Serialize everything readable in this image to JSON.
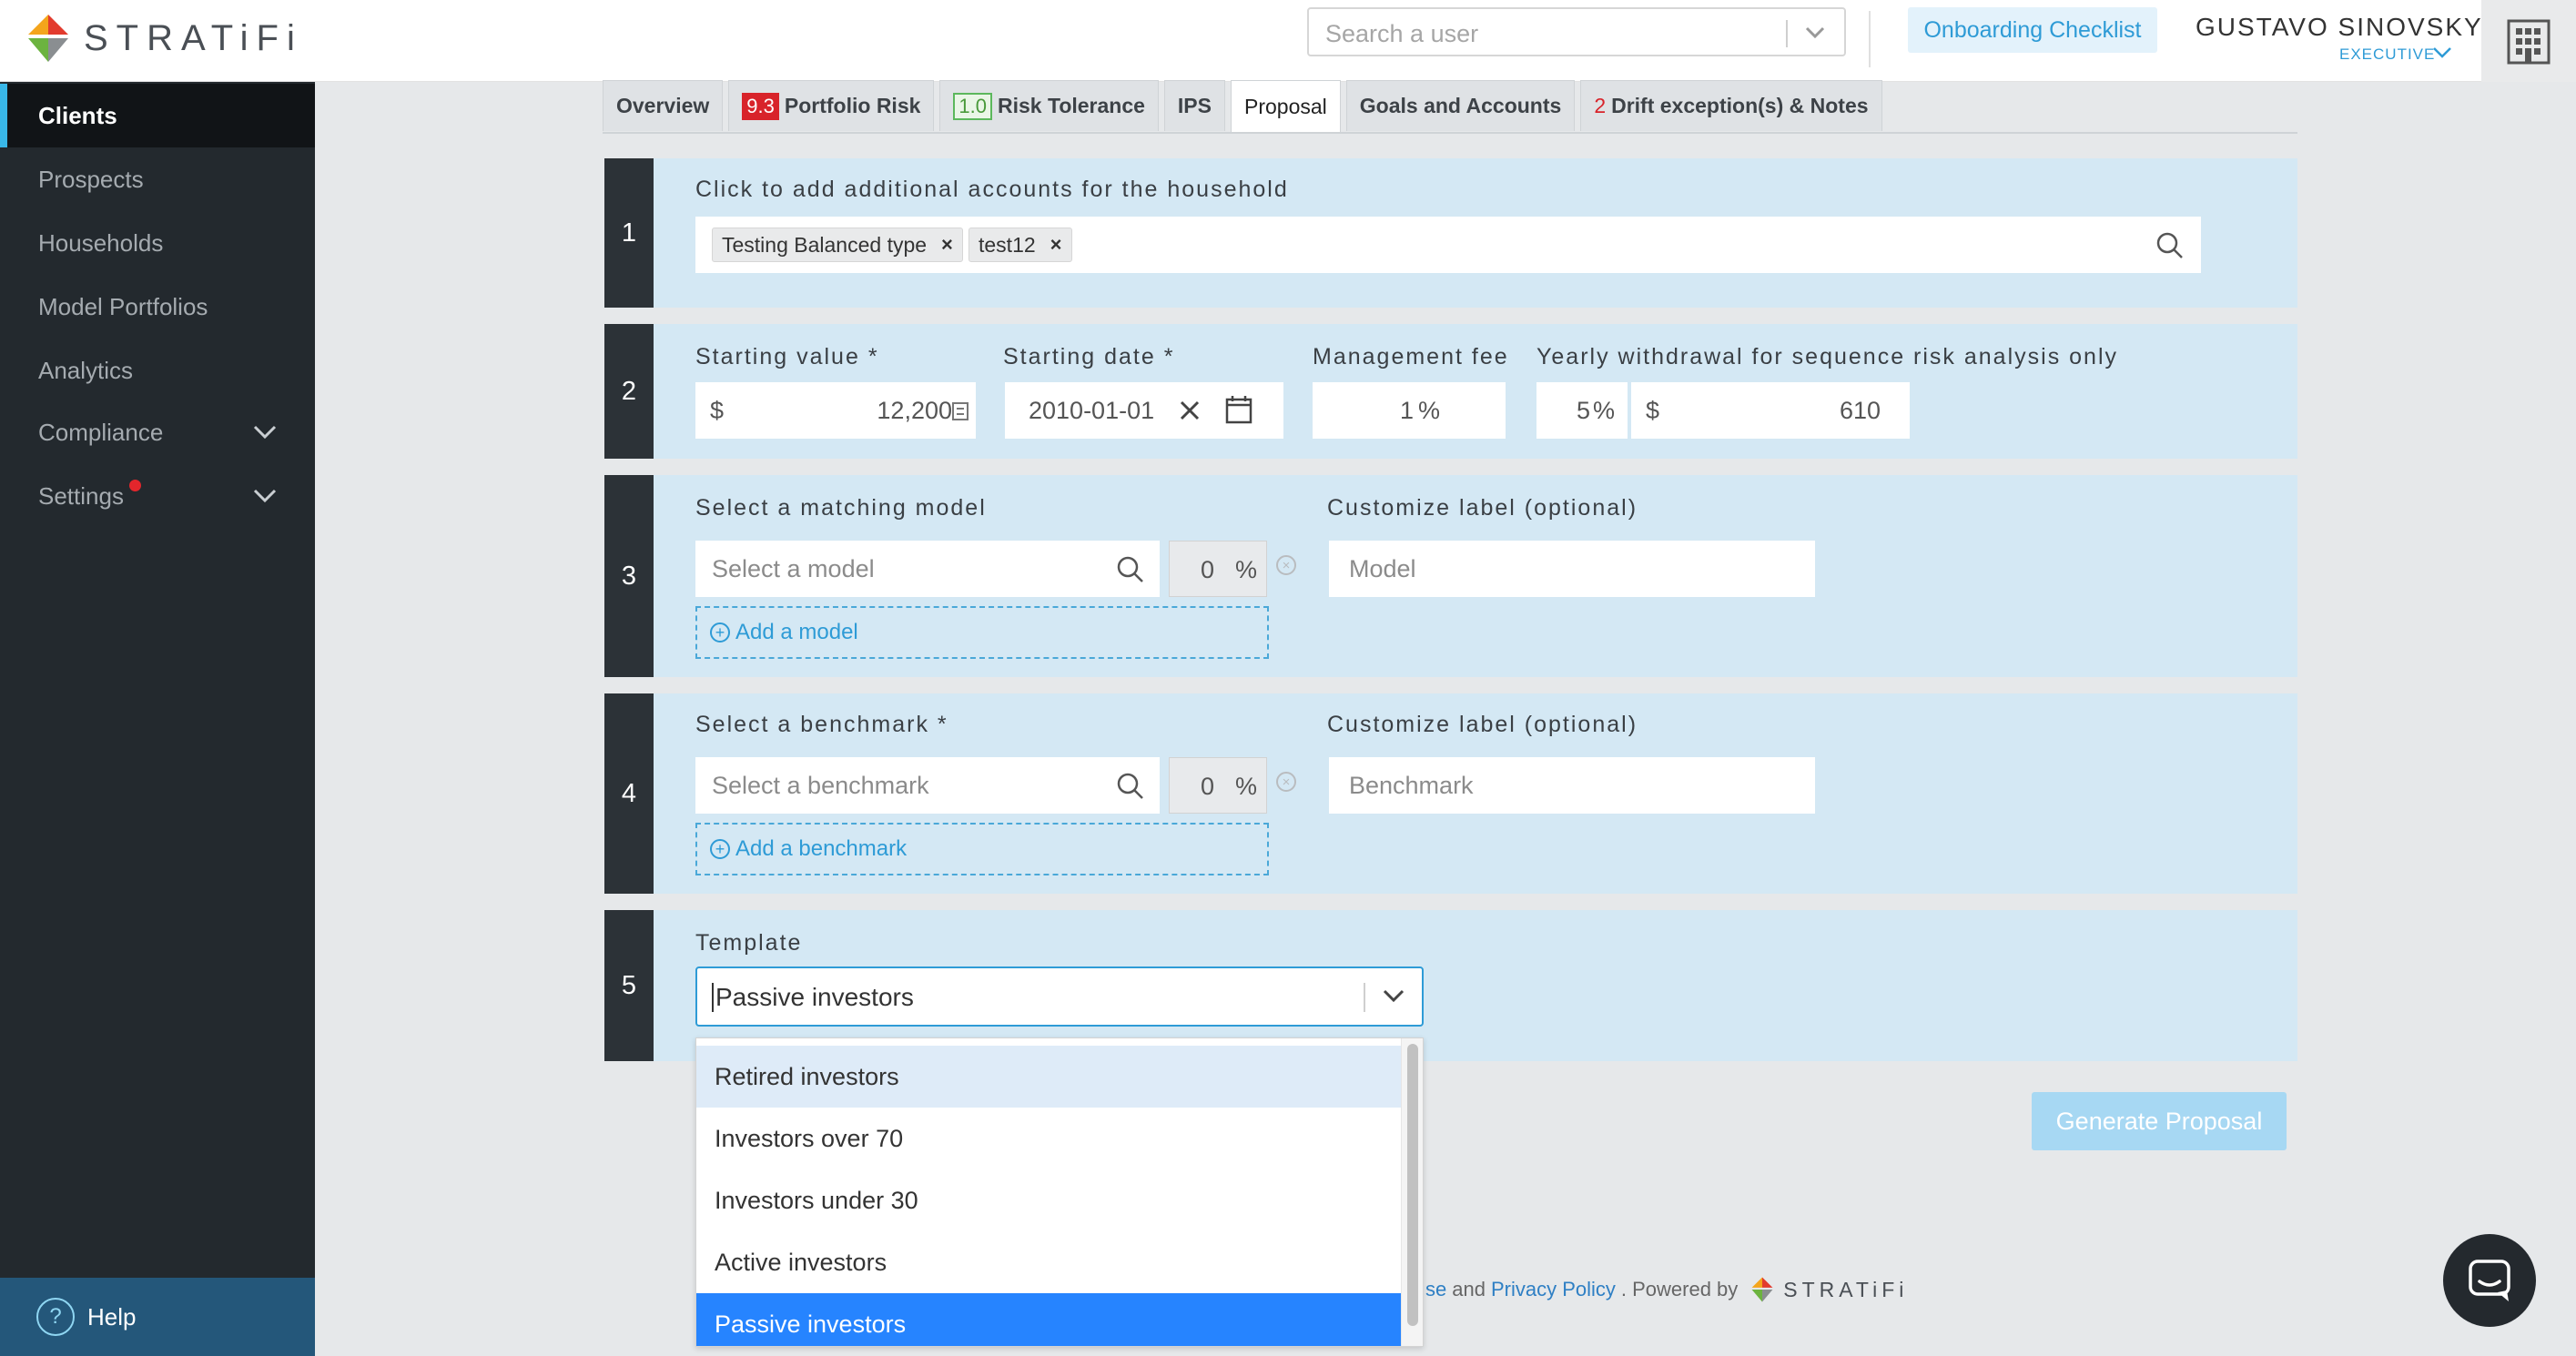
{
  "header": {
    "logo_text": "STRATiFi",
    "search_placeholder": "Search a user",
    "onboarding_label": "Onboarding Checklist",
    "user_name": "GUSTAVO SINOVSKY",
    "user_role": "EXECUTIVE"
  },
  "sidebar": {
    "items": [
      {
        "label": "Clients"
      },
      {
        "label": "Prospects"
      },
      {
        "label": "Households"
      },
      {
        "label": "Model Portfolios"
      },
      {
        "label": "Analytics"
      },
      {
        "label": "Compliance"
      },
      {
        "label": "Settings"
      }
    ],
    "help_label": "Help"
  },
  "tabs": {
    "overview": "Overview",
    "risk_badge": "9.3",
    "risk_label": "Portfolio Risk",
    "tolerance_badge": "1.0",
    "tolerance_label": "Risk Tolerance",
    "ips": "IPS",
    "proposal": "Proposal",
    "goals": "Goals and Accounts",
    "drift_count": "2",
    "drift_label": "Drift exception(s) & Notes"
  },
  "step1": {
    "num": "1",
    "label": "Click to add additional accounts for the household",
    "tags": [
      "Testing Balanced type",
      "test12"
    ]
  },
  "step2": {
    "num": "2",
    "starting_value_label": "Starting value *",
    "currency": "$",
    "starting_value": "12,200",
    "starting_date_label": "Starting date *",
    "starting_date": "2010-01-01",
    "fee_label": "Management fee",
    "fee": "1",
    "percent": "%",
    "withdrawal_label": "Yearly withdrawal for sequence risk analysis only",
    "withdrawal_pct": "5",
    "withdrawal_amount": "610"
  },
  "step3": {
    "num": "3",
    "label": "Select a matching model",
    "placeholder": "Select a model",
    "pct": "0",
    "add_label": "Add a model",
    "custom_label": "Customize label (optional)",
    "custom_placeholder": "Model"
  },
  "step4": {
    "num": "4",
    "label": "Select a benchmark *",
    "placeholder": "Select a benchmark",
    "pct": "0",
    "add_label": "Add a benchmark",
    "custom_label": "Customize label (optional)",
    "custom_placeholder": "Benchmark"
  },
  "step5": {
    "num": "5",
    "label": "Template",
    "selected": "Passive investors",
    "options": [
      "Retired investors",
      "Investors over 70",
      "Investors under 30",
      "Active investors",
      "Passive investors"
    ]
  },
  "generate_label": "Generate Proposal",
  "footer": {
    "frag1": "se",
    "and": "and",
    "privacy": "Privacy Policy",
    "powered": ". Powered by",
    "brand": "STRATiFi"
  },
  "colors": {
    "accent": "#2e9bd6",
    "sidebar": "#23292e",
    "step_bg": "#d4e8f4",
    "selected_option": "#2684ff",
    "badge_red": "#d8232a"
  }
}
